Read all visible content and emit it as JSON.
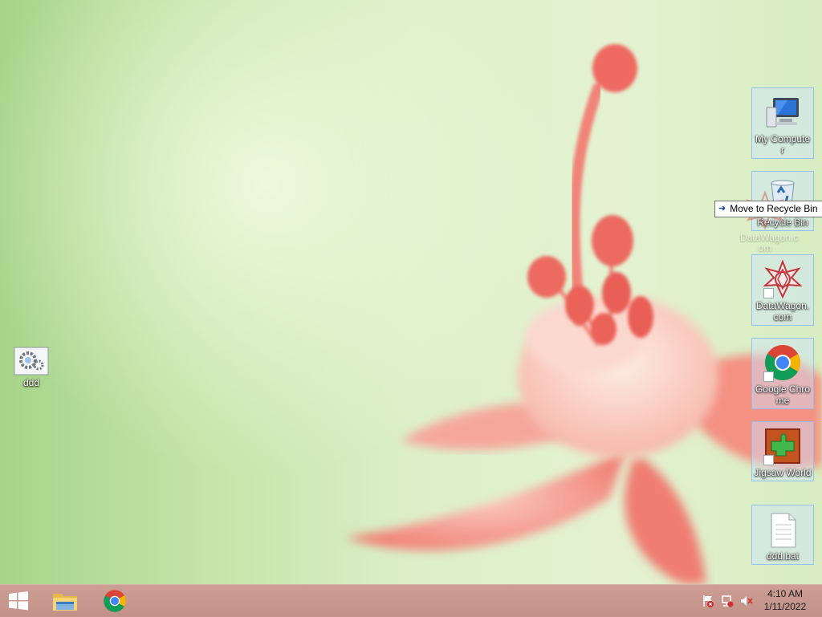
{
  "desktop": {
    "icons": [
      {
        "label": "My Computer",
        "icon": "computer-icon"
      },
      {
        "label": "Recycle Bin",
        "icon": "recycle-bin-icon"
      },
      {
        "label": "DataWagon.com",
        "icon": "datawagon-icon"
      },
      {
        "label": "Google Chrome",
        "icon": "chrome-icon"
      },
      {
        "label": "Jigsaw World",
        "icon": "jigsaw-icon"
      },
      {
        "label": "ddd.bat",
        "icon": "batch-file-icon"
      },
      {
        "label": "ddd",
        "icon": "settings-gear-icon"
      }
    ],
    "drag_ghost_label": "DataWagon.c om",
    "tooltip": {
      "text": "Move to Recycle Bin",
      "icon": "arrow-right-icon"
    }
  },
  "taskbar": {
    "buttons": [
      {
        "name": "Start",
        "icon": "windows-logo-icon"
      },
      {
        "name": "File Explorer",
        "icon": "file-explorer-icon"
      },
      {
        "name": "Google Chrome",
        "icon": "chrome-icon"
      }
    ],
    "tray": [
      "action-center-flag-icon",
      "network-icon",
      "volume-muted-icon"
    ],
    "clock": {
      "time": "4:10 AM",
      "date": "1/11/2022"
    }
  },
  "colors": {
    "taskbar": "#c2928a",
    "wallpaper_green": "#c4e4a8",
    "flower_pink": "#f28a80"
  }
}
